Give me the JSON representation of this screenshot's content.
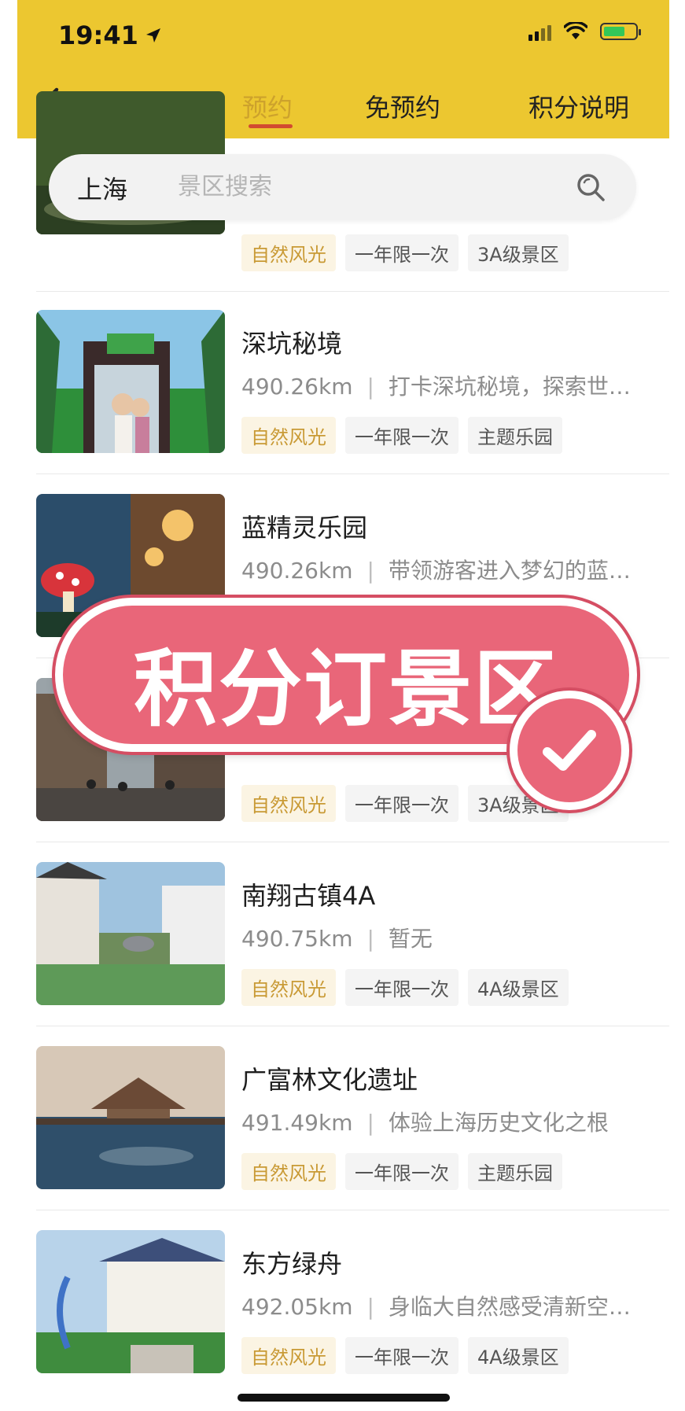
{
  "status": {
    "time": "19:41"
  },
  "nav": {
    "tabs": [
      {
        "label": "预约",
        "active": true
      },
      {
        "label": "免预约",
        "active": false
      },
      {
        "label": "积分说明",
        "active": false
      }
    ]
  },
  "search": {
    "city": "上海",
    "placeholder": "景区搜索"
  },
  "items": [
    {
      "title": "",
      "distance": "",
      "desc": "",
      "tags": [
        "自然风光",
        "一年限一次",
        "3A级景区"
      ]
    },
    {
      "title": "深坑秘境",
      "distance": "490.26km",
      "desc": "打卡深坑秘境，探索世…",
      "tags": [
        "自然风光",
        "一年限一次",
        "主题乐园"
      ]
    },
    {
      "title": "蓝精灵乐园",
      "distance": "490.26km",
      "desc": "带领游客进入梦幻的蓝…",
      "tags": []
    },
    {
      "title": "",
      "distance": "",
      "desc": "",
      "tags": [
        "自然风光",
        "一年限一次",
        "3A级景区"
      ]
    },
    {
      "title": "南翔古镇4A",
      "distance": "490.75km",
      "desc": "暂无",
      "tags": [
        "自然风光",
        "一年限一次",
        "4A级景区"
      ]
    },
    {
      "title": "广富林文化遗址",
      "distance": "491.49km",
      "desc": "体验上海历史文化之根",
      "tags": [
        "自然风光",
        "一年限一次",
        "主题乐园"
      ]
    },
    {
      "title": "东方绿舟",
      "distance": "492.05km",
      "desc": "身临大自然感受清新空…",
      "tags": [
        "自然风光",
        "一年限一次",
        "4A级景区"
      ]
    }
  ],
  "overlay": {
    "text": "积分订景区"
  },
  "colors": {
    "header": "#ecc730",
    "activeTab": "#cda22c",
    "stamp": "#e96679",
    "natureTag": "#c99a35"
  }
}
